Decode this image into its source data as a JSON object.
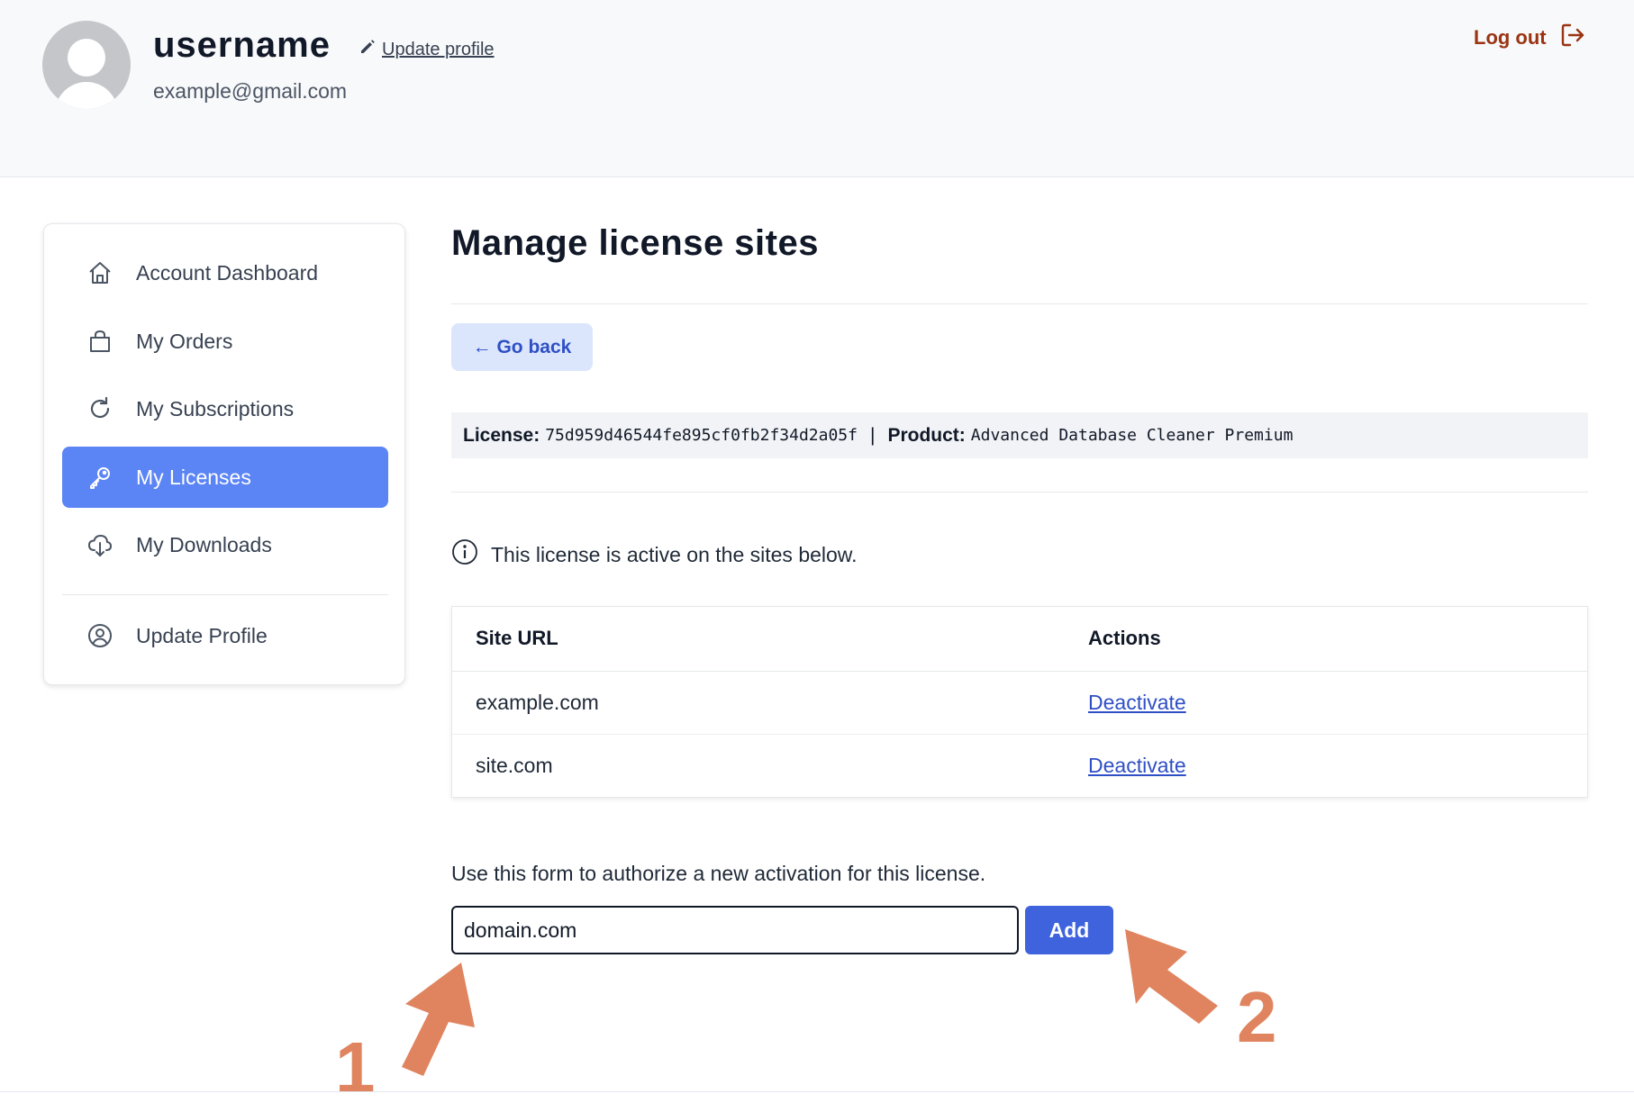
{
  "header": {
    "username": "username",
    "update_profile": "Update profile",
    "email": "example@gmail.com",
    "logout": "Log out"
  },
  "sidebar": {
    "items": [
      {
        "label": "Account Dashboard",
        "icon": "home-icon"
      },
      {
        "label": "My Orders",
        "icon": "shopping-bag-icon"
      },
      {
        "label": "My Subscriptions",
        "icon": "refresh-icon"
      },
      {
        "label": "My Licenses",
        "icon": "key-icon",
        "active": true
      },
      {
        "label": "My Downloads",
        "icon": "cloud-download-icon"
      },
      {
        "label": "Update Profile",
        "icon": "user-circle-icon"
      }
    ]
  },
  "main": {
    "title": "Manage license sites",
    "go_back": "← Go back",
    "license_label": "License:",
    "license_key": "75d959d46544fe895cf0fb2f34d2a05f",
    "separator": "|",
    "product_label": "Product:",
    "product_name": "Advanced Database Cleaner Premium",
    "info_text": "This license is active on the sites below.",
    "table": {
      "headers": [
        "Site URL",
        "Actions"
      ],
      "rows": [
        {
          "site": "example.com",
          "action": "Deactivate"
        },
        {
          "site": "site.com",
          "action": "Deactivate"
        }
      ]
    },
    "form_hint": "Use this form to authorize a new activation for this license.",
    "domain_value": "domain.com",
    "add_label": "Add"
  },
  "annotations": {
    "step1": "1",
    "step2": "2",
    "color": "#e0845f"
  },
  "colors": {
    "accent": "#5b84f5",
    "button": "#3e63dd",
    "link": "#2f4fc5",
    "logout": "#9a3412"
  }
}
